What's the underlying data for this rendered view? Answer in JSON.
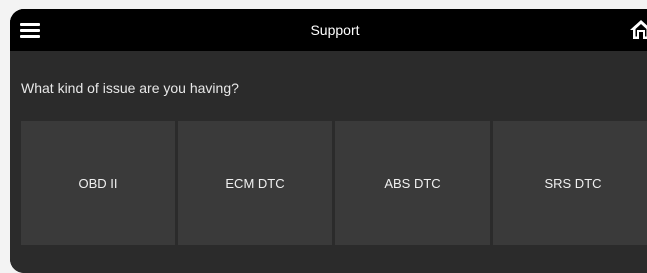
{
  "header": {
    "title": "Support",
    "menu_icon": "hamburger-menu-icon",
    "home_icon": "home-icon"
  },
  "prompt": {
    "question": "What kind of issue are you having?"
  },
  "options": [
    {
      "label": "OBD II"
    },
    {
      "label": "ECM DTC"
    },
    {
      "label": "ABS DTC"
    },
    {
      "label": "SRS DTC"
    }
  ],
  "colors": {
    "header_bg": "#000000",
    "screen_bg": "#2b2b2b",
    "tile_bg": "#3a3a3a",
    "text": "#ffffff"
  }
}
